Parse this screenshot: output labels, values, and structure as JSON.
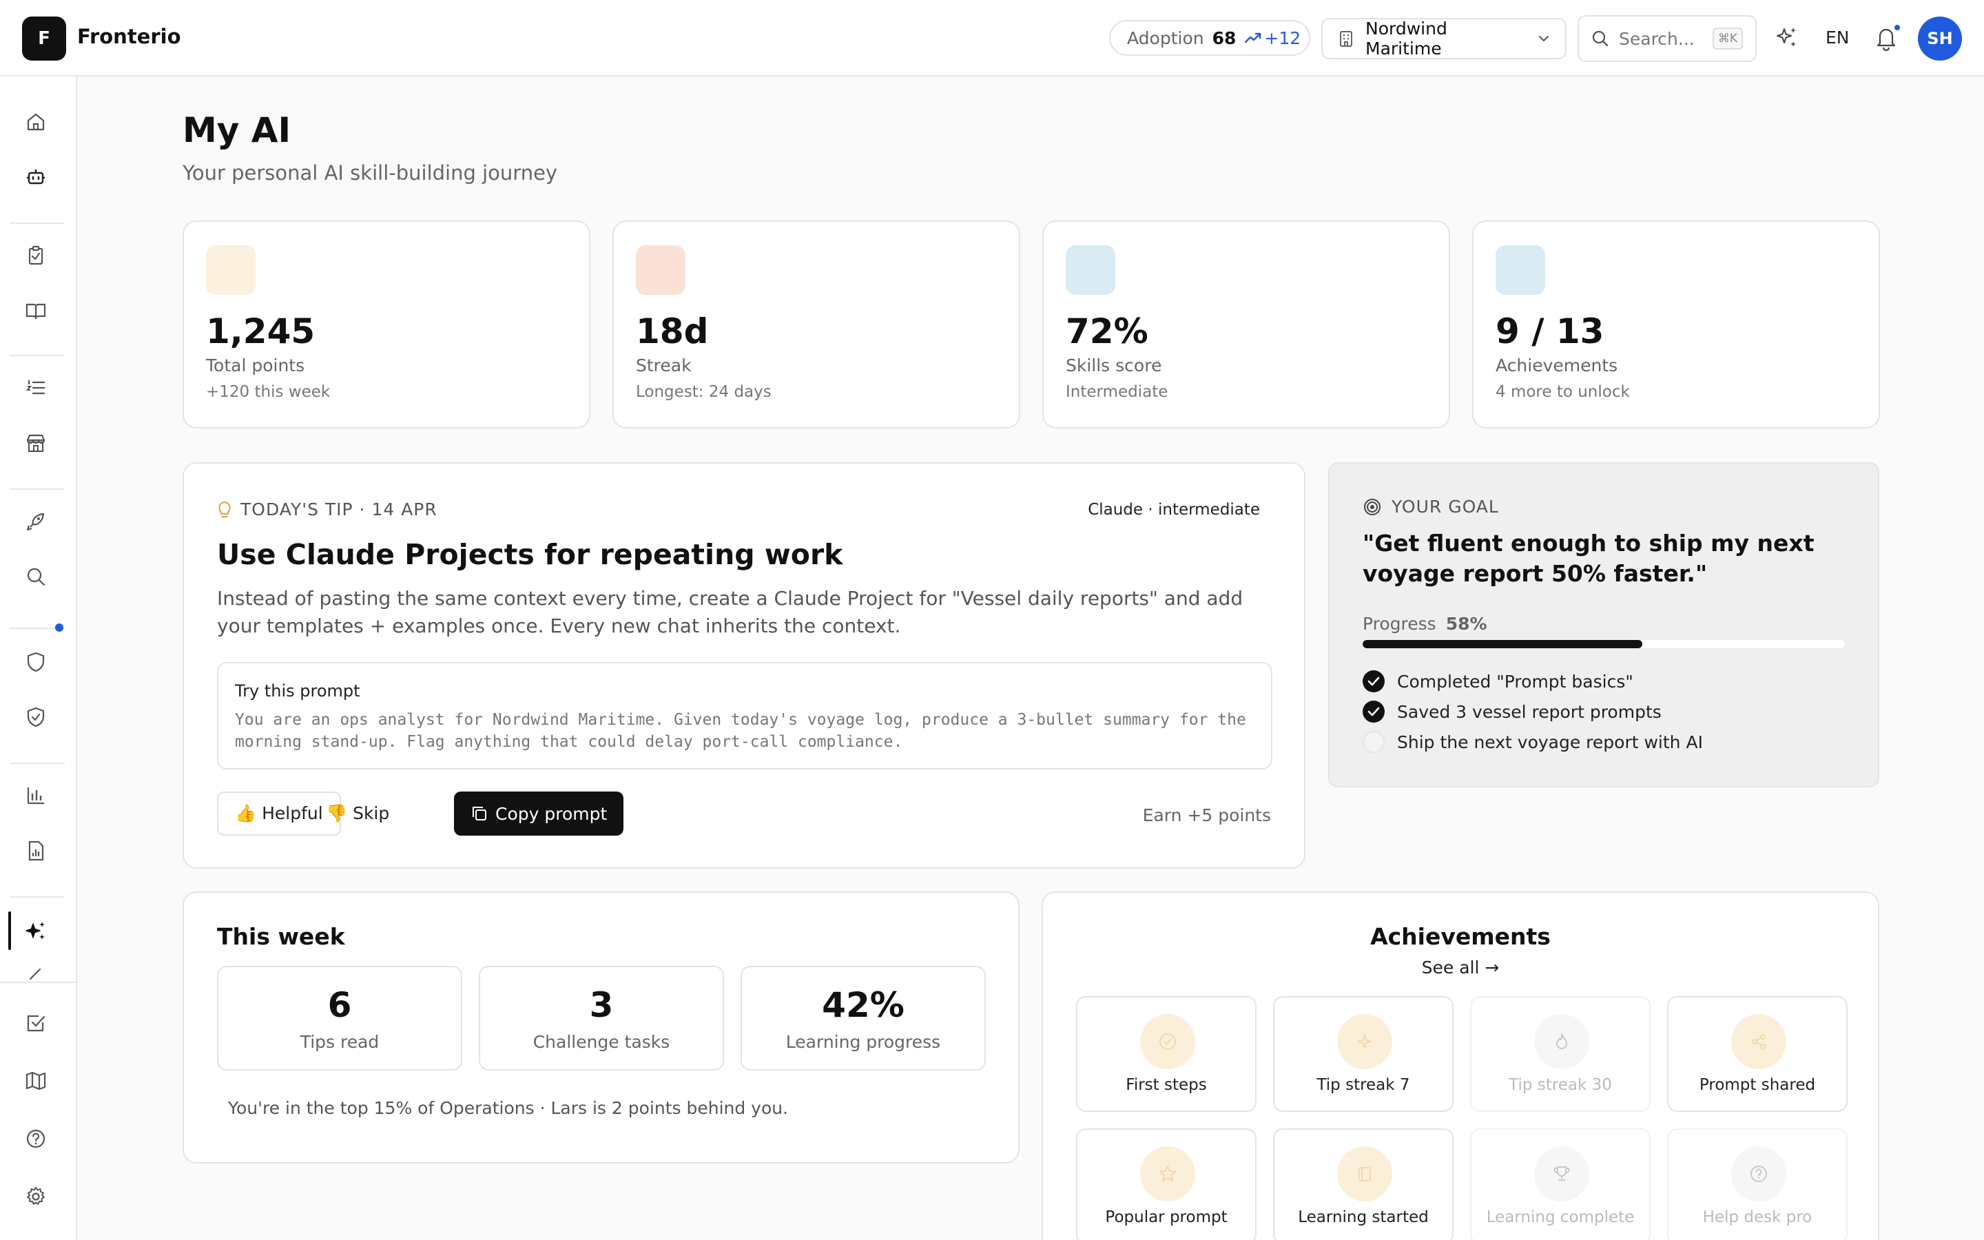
{
  "header": {
    "logo_letter": "F",
    "brand": "Fronterio",
    "adoption": {
      "label": "Adoption",
      "value": "68",
      "delta": "+12"
    },
    "org": {
      "name": "Nordwind Maritime"
    },
    "search": {
      "placeholder": "Search...",
      "shortcut": "⌘K"
    },
    "language": "EN",
    "avatar_initials": "SH",
    "colors": {
      "accent": "#1f5bdc"
    }
  },
  "sidebar": {
    "items": [
      {
        "icon": "home-icon"
      },
      {
        "icon": "robot-icon"
      },
      {
        "icon": "clipboard-check-icon"
      },
      {
        "icon": "book-open-icon"
      },
      {
        "icon": "list-ordered-icon"
      },
      {
        "icon": "store-icon"
      },
      {
        "icon": "rocket-icon"
      },
      {
        "icon": "search-icon"
      },
      {
        "icon": "shield-icon"
      },
      {
        "icon": "shield-check-icon"
      },
      {
        "icon": "bar-chart-icon"
      },
      {
        "icon": "file-chart-icon"
      },
      {
        "icon": "sparkles-icon",
        "active": true
      },
      {
        "icon": "square-check-icon"
      },
      {
        "icon": "map-icon"
      },
      {
        "icon": "help-circle-icon"
      },
      {
        "icon": "settings-icon"
      }
    ]
  },
  "page": {
    "title": "My AI",
    "subtitle": "Your personal AI skill-building journey"
  },
  "stats": [
    {
      "value": "1,245",
      "label": "Total points",
      "sub": "+120 this week",
      "color": "#fcf0de"
    },
    {
      "value": "18d",
      "label": "Streak",
      "sub": "Longest: 24 days",
      "color": "#fbe1d6"
    },
    {
      "value": "72%",
      "label": "Skills score",
      "sub": "Intermediate",
      "color": "#d9ecf3"
    },
    {
      "value": "9 / 13",
      "label": "Achievements",
      "sub": "4 more to unlock",
      "color": "#d9ebf3"
    }
  ],
  "tip": {
    "eyebrow": "TODAY'S TIP · 14 APR",
    "tag": "Claude · intermediate",
    "title": "Use Claude Projects for repeating work",
    "body": "Instead of pasting the same context every time, create a Claude Project for \"Vessel daily reports\" and add your templates + examples once. Every new chat inherits the context.",
    "prompt_label": "Try this prompt",
    "prompt_text": "You are an ops analyst for Nordwind Maritime. Given today's voyage log, produce a 3-bullet summary for the morning stand-up. Flag anything that could delay port-call compliance.",
    "helpful_label": "👍 Helpful",
    "skip_label": "👎 Skip",
    "copy_label": "Copy prompt",
    "earn": "Earn +5 points"
  },
  "goal": {
    "eyebrow": "YOUR GOAL",
    "quote": "\"Get fluent enough to ship my next voyage report 50% faster.\"",
    "progress_label": "Progress",
    "progress_value": "58%",
    "progress_fraction": 0.58,
    "items": [
      {
        "label": "Completed \"Prompt basics\"",
        "done": true
      },
      {
        "label": "Saved 3 vessel report prompts",
        "done": true
      },
      {
        "label": "Ship the next voyage report with AI",
        "done": false
      }
    ]
  },
  "week": {
    "title": "This week",
    "stats": [
      {
        "value": "6",
        "label": "Tips read"
      },
      {
        "value": "3",
        "label": "Challenge tasks"
      },
      {
        "value": "42%",
        "label": "Learning progress"
      }
    ],
    "footer": "You're in the top 15% of Operations · Lars is 2 points behind you."
  },
  "achievements": {
    "title": "Achievements",
    "see_all": "See all →",
    "items": [
      {
        "label": "First steps",
        "icon": "check-circle-icon",
        "unlocked": true
      },
      {
        "label": "Tip streak 7",
        "icon": "sparkle-icon",
        "unlocked": true
      },
      {
        "label": "Tip streak 30",
        "icon": "flame-icon",
        "unlocked": false
      },
      {
        "label": "Prompt shared",
        "icon": "share-icon",
        "unlocked": true
      },
      {
        "label": "Popular prompt",
        "icon": "star-icon",
        "unlocked": true
      },
      {
        "label": "Learning started",
        "icon": "book-icon",
        "unlocked": true
      },
      {
        "label": "Learning complete",
        "icon": "trophy-icon",
        "unlocked": false
      },
      {
        "label": "Help desk pro",
        "icon": "help-circle-icon",
        "unlocked": false
      }
    ]
  }
}
